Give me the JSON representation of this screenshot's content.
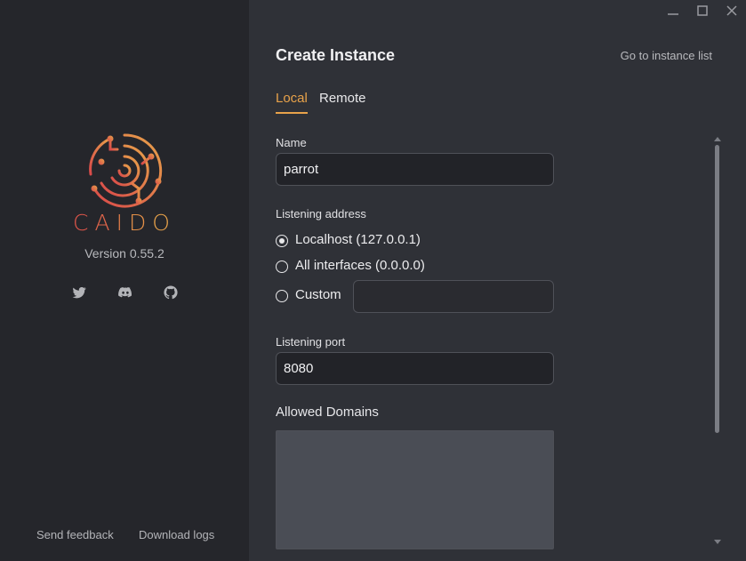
{
  "sidebar": {
    "brand_letters": [
      "C",
      "A",
      "I",
      "D",
      "O"
    ],
    "version": "Version 0.55.2",
    "social": [
      "twitter-icon",
      "discord-icon",
      "github-icon"
    ],
    "send_feedback": "Send feedback",
    "download_logs": "Download logs"
  },
  "window": {
    "controls": [
      "minimize-icon",
      "maximize-icon",
      "close-icon"
    ]
  },
  "main": {
    "title": "Create Instance",
    "goto_list": "Go to instance list",
    "tabs": [
      {
        "label": "Local",
        "active": true
      },
      {
        "label": "Remote",
        "active": false
      }
    ],
    "name_label": "Name",
    "name_value": "parrot",
    "listening_address_label": "Listening address",
    "address_options": [
      {
        "label": "Localhost (127.0.0.1)",
        "checked": true
      },
      {
        "label": "All interfaces (0.0.0.0)",
        "checked": false
      },
      {
        "label": "Custom",
        "checked": false
      }
    ],
    "custom_value": "",
    "listening_port_label": "Listening port",
    "port_value": "8080",
    "allowed_domains_label": "Allowed Domains",
    "allowed_domains_value": ""
  },
  "colors": {
    "accent": "#e8a24a",
    "sidebar_bg": "#25262b",
    "main_bg": "#2f3137"
  }
}
